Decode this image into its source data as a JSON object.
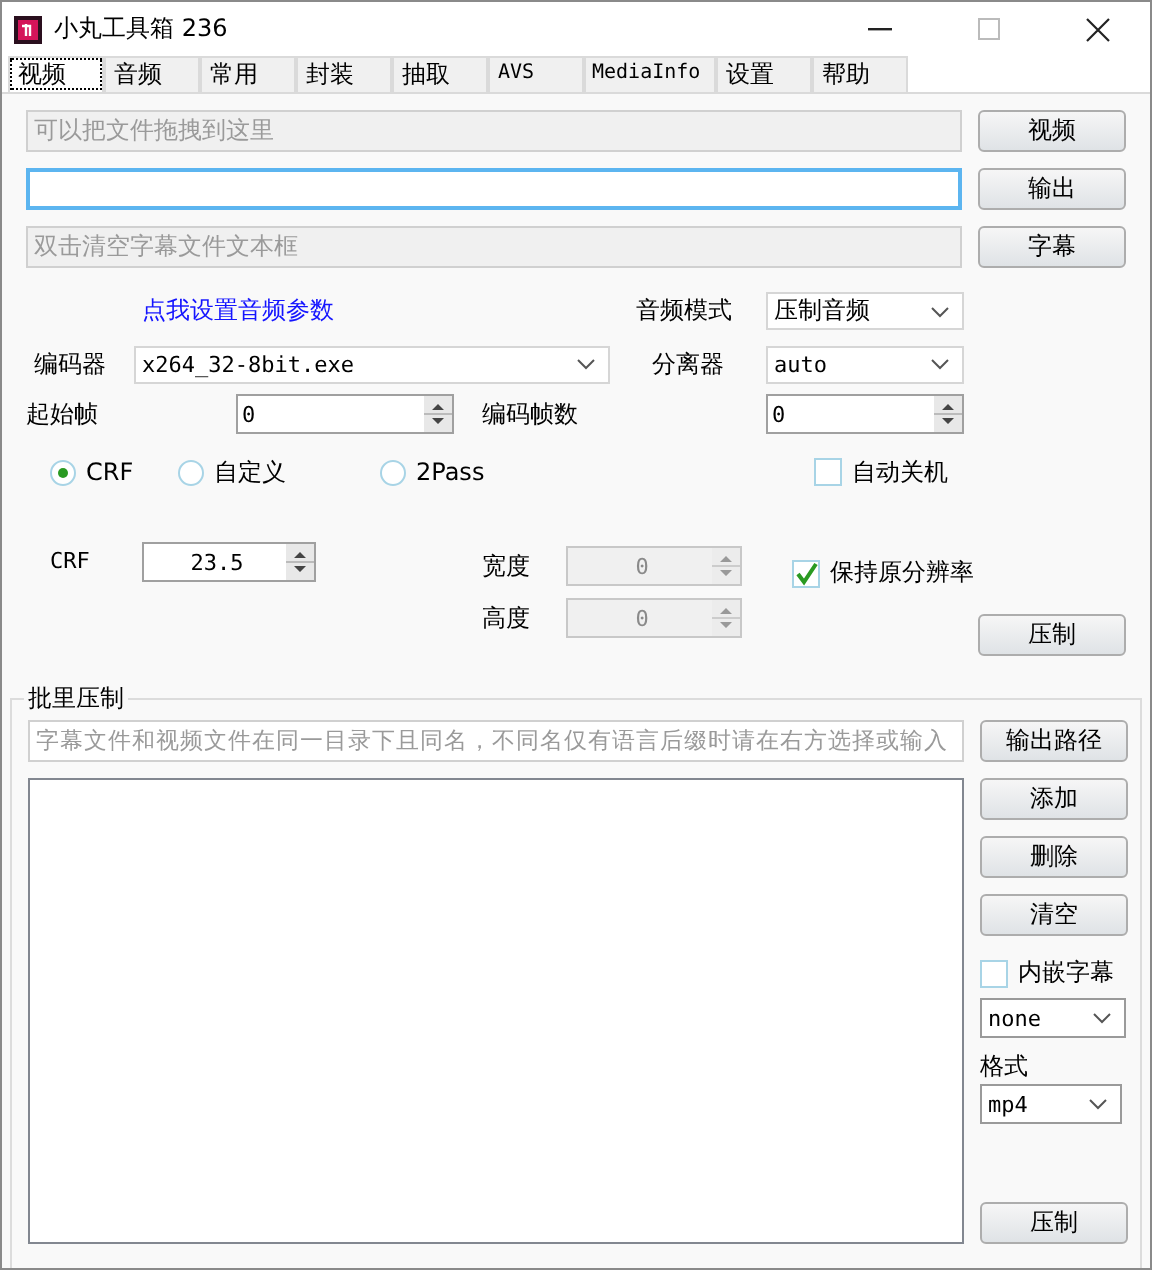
{
  "window": {
    "title": "小丸工具箱 236"
  },
  "tabs": [
    {
      "label": "视频",
      "selected": true
    },
    {
      "label": "音频",
      "selected": false
    },
    {
      "label": "常用",
      "selected": false
    },
    {
      "label": "封装",
      "selected": false
    },
    {
      "label": "抽取",
      "selected": false
    },
    {
      "label": "AVS",
      "selected": false
    },
    {
      "label": "MediaInfo",
      "selected": false
    },
    {
      "label": "设置",
      "selected": false
    },
    {
      "label": "帮助",
      "selected": false
    }
  ],
  "drop_field": {
    "placeholder": "可以把文件拖拽到这里",
    "button": "视频"
  },
  "output_field": {
    "focused": true,
    "button": "输出"
  },
  "subtitle_field": {
    "placeholder": "双击清空字幕文件文本框",
    "button": "字幕"
  },
  "audio_link": "点我设置音频参数",
  "audio_mode": {
    "label": "音频模式",
    "value": "压制音频"
  },
  "encoder": {
    "label": "编码器",
    "value": "x264_32-8bit.exe"
  },
  "demuxer": {
    "label": "分离器",
    "value": "auto"
  },
  "start_frame": {
    "label": "起始帧",
    "value": "0"
  },
  "frame_count": {
    "label": "编码帧数",
    "value": "0"
  },
  "modes": [
    {
      "label": "CRF",
      "selected": true
    },
    {
      "label": "自定义",
      "selected": false
    },
    {
      "label": "2Pass",
      "selected": false
    }
  ],
  "auto_shutdown": {
    "label": "自动关机",
    "checked": false
  },
  "crf": {
    "label": "CRF",
    "value": "23.5"
  },
  "width": {
    "label": "宽度",
    "value": "0",
    "disabled": true
  },
  "height": {
    "label": "高度",
    "value": "0",
    "disabled": true
  },
  "keep_resolution": {
    "label": "保持原分辨率",
    "checked": true
  },
  "encode_button": "压制",
  "batch": {
    "title": "批里压制",
    "hint_field": {
      "placeholder": "字幕文件和视频文件在同一目录下且同名，不同名仅有语言后缀时请在右方选择或输入"
    },
    "output_path_button": "输出路径",
    "buttons": [
      "添加",
      "删除",
      "清空"
    ],
    "embed_subtitles": {
      "label": "内嵌字幕",
      "checked": false
    },
    "subtitle_select": "none",
    "format_label": "格式",
    "format_select": "mp4",
    "encode_button": "压制"
  }
}
